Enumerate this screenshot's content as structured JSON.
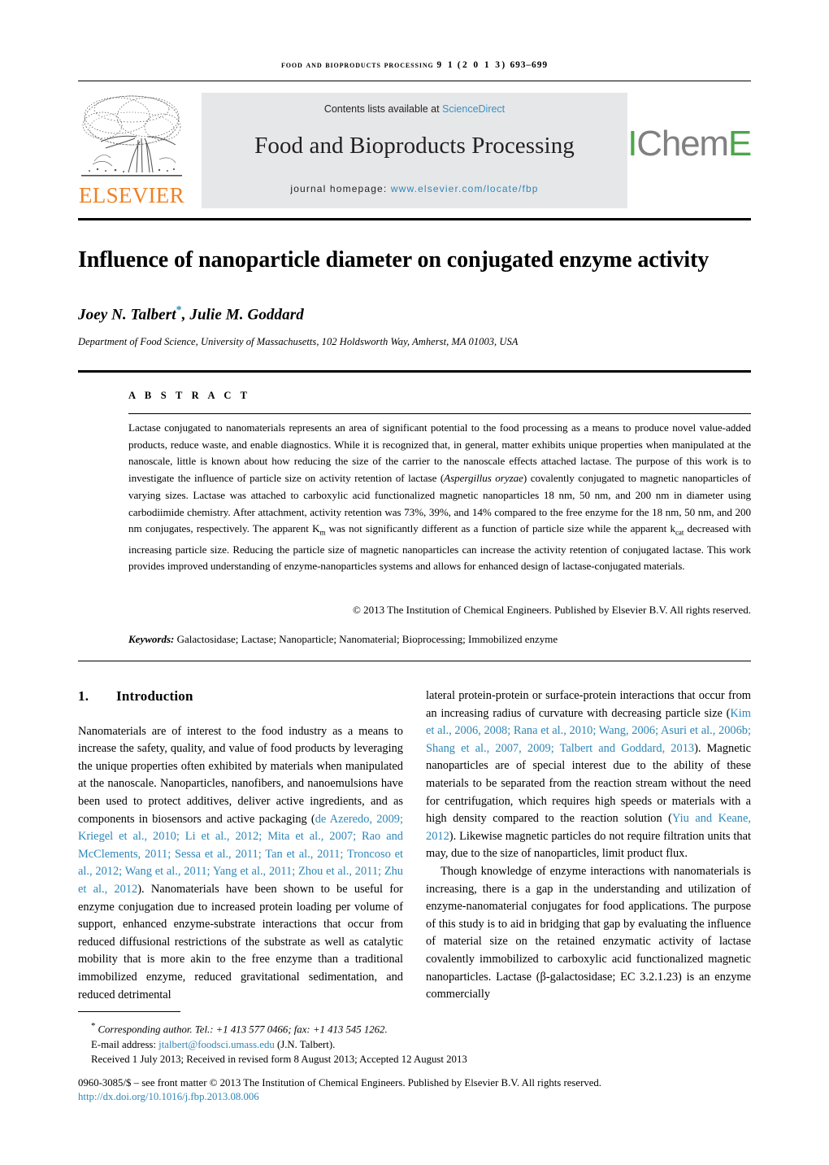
{
  "running_head": {
    "journal": "FOOD AND BIOPRODUCTS PROCESSING",
    "volume_issue": "9 1",
    "year": "(2 0 1 3)",
    "pages": "693–699"
  },
  "masthead": {
    "contents_prefix": "Contents lists available at ",
    "sciencedirect": "ScienceDirect",
    "journal_name": "Food and Bioproducts Processing",
    "homepage_prefix": "journal homepage:",
    "homepage_url": "www.elsevier.com/locate/fbp",
    "elsevier_wordmark": "ELSEVIER",
    "icheme_i": "I",
    "icheme_chem": "Chem",
    "icheme_e": "E",
    "elsevier_orange": "#F08020",
    "link_blue": "#2E86B8",
    "icheme_green": "#4CA64C",
    "icheme_gray": "#808080",
    "banner_bg": "#E6E7E8"
  },
  "article": {
    "title": "Influence of nanoparticle diameter on conjugated enzyme activity",
    "authors": "Joey N. Talbert",
    "corresponding_marker": "*",
    "authors_rest": ", Julie M. Goddard",
    "affiliation": "Department of Food Science, University of Massachusetts, 102 Holdsworth Way, Amherst, MA 01003, USA"
  },
  "abstract": {
    "label": "A B S T R A C T",
    "p1_a": "Lactase conjugated to nanomaterials represents an area of significant potential to the food processing as a means to produce novel value-added products, reduce waste, and enable diagnostics. While it is recognized that, in general, matter exhibits unique properties when manipulated at the nanoscale, little is known about how reducing the size of the carrier to the nanoscale effects attached lactase. The purpose of this work is to investigate the influence of particle size on activity retention of lactase (",
    "species": "Aspergillus oryzae",
    "p1_b": ") covalently conjugated to magnetic nanoparticles of varying sizes. Lactase was attached to carboxylic acid functionalized magnetic nanoparticles 18 nm, 50 nm, and 200 nm in diameter using carbodiimide chemistry. After attachment, activity retention was 73%, 39%, and 14% compared to the free enzyme for the 18 nm, 50 nm, and 200 nm conjugates, respectively. The apparent K",
    "km_sub": "m",
    "p1_c": " was not significantly different as a function of particle size while the apparent k",
    "kcat_sub": "cat",
    "p1_d": " decreased with increasing particle size. Reducing the particle size of magnetic nanoparticles can increase the activity retention of conjugated lactase. This work provides improved understanding of enzyme-nanoparticles systems and allows for enhanced design of lactase-conjugated materials.",
    "copyright": "© 2013 The Institution of Chemical Engineers. Published by Elsevier B.V. All rights reserved.",
    "keywords_label": "Keywords:",
    "keywords_value": "Galactosidase; Lactase; Nanoparticle; Nanomaterial; Bioprocessing; Immobilized enzyme"
  },
  "body": {
    "section_number": "1.",
    "section_title": "Introduction",
    "left_p1_a": "Nanomaterials are of interest to the food industry as a means to increase the safety, quality, and value of food products by leveraging the unique properties often exhibited by materials when manipulated at the nanoscale. Nanoparticles, nanofibers, and nanoemulsions have been used to protect additives, deliver active ingredients, and as components in biosensors and active packaging (",
    "left_cite1": "de Azeredo, 2009; Kriegel et al., 2010; Li et al., 2012; Mita et al., 2007; Rao and McClements, 2011; Sessa et al., 2011; Tan et al., 2011; Troncoso et al., 2012; Wang et al., 2011; Yang et al., 2011; Zhou et al., 2011; Zhu et al., 2012",
    "left_p1_b": "). Nanomaterials have been shown to be useful for enzyme conjugation due to increased protein loading per volume of support, enhanced enzyme-substrate interactions that occur from reduced diffusional restrictions of the substrate as well as catalytic mobility that is more akin to the free enzyme than a traditional immobilized enzyme, reduced gravitational sedimentation, and reduced detrimental",
    "right_p1_a": "lateral protein-protein or surface-protein interactions that occur from an increasing radius of curvature with decreasing particle size (",
    "right_cite1": "Kim et al., 2006, 2008; Rana et al., 2010; Wang, 2006; Asuri et al., 2006b; Shang et al., 2007, 2009; Talbert and Goddard, 2013",
    "right_p1_b": "). Magnetic nanoparticles are of special interest due to the ability of these materials to be separated from the reaction stream without the need for centrifugation, which requires high speeds or materials with a high density compared to the reaction solution (",
    "right_cite2": "Yiu and Keane, 2012",
    "right_p1_c": "). Likewise magnetic particles do not require filtration units that may, due to the size of nanoparticles, limit product flux.",
    "right_p2": "Though knowledge of enzyme interactions with nanomaterials is increasing, there is a gap in the understanding and utilization of enzyme-nanomaterial conjugates for food applications. The purpose of this study is to aid in bridging that gap by evaluating the influence of material size on the retained enzymatic activity of lactase covalently immobilized to carboxylic acid functionalized magnetic nanoparticles. Lactase (β-galactosidase; EC 3.2.1.23) is an enzyme commercially"
  },
  "footnotes": {
    "corresponding": "Corresponding author. Tel.: +1 413 577 0466; fax: +1 413 545 1262.",
    "email_label": "E-mail address:",
    "email": "jtalbert@foodsci.umass.edu",
    "email_owner": "(J.N. Talbert).",
    "dates": "Received 1 July 2013; Received in revised form 8 August 2013; Accepted 12 August 2013",
    "frontmatter": "0960-3085/$ – see front matter © 2013 The Institution of Chemical Engineers. Published by Elsevier B.V. All rights reserved.",
    "doi": "http://dx.doi.org/10.1016/j.fbp.2013.08.006"
  }
}
